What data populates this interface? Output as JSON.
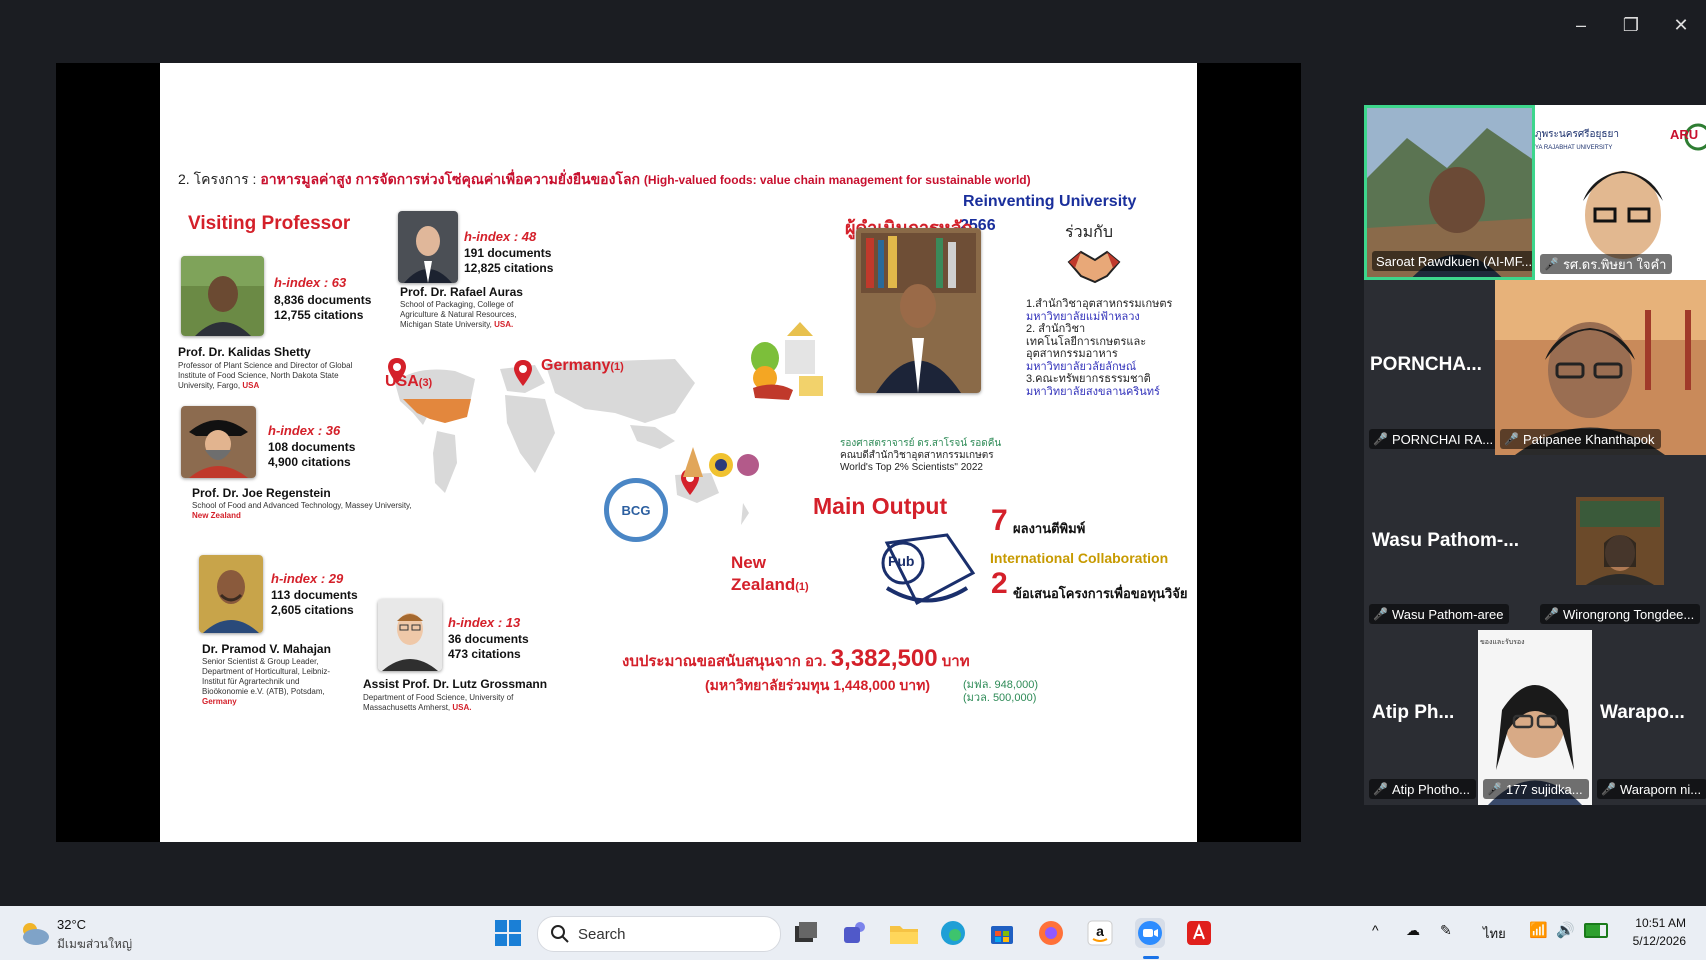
{
  "window": {
    "minimize_icon": "–",
    "restore_icon": "❐",
    "close_icon": "✕"
  },
  "slide": {
    "heading_prefix": "2. โครงการ : ",
    "heading_thai": "อาหารมูลค่าสูง การจัดการห่วงโซ่คุณค่าเพื่อความยั่งยืนของโลก",
    "heading_en": "(High-valued foods: value chain management for sustainable world)",
    "visiting_title": "Visiting Professor",
    "professors": [
      {
        "h": "h-index : 63",
        "docs": "8,836 documents",
        "cites": "12,755 citations",
        "name": "Prof. Dr. Kalidas Shetty",
        "aff": "Professor of Plant Science and Director of Global Institute of Food Science, North Dakota State University, Fargo,",
        "country": "USA"
      },
      {
        "h": "h-index : 48",
        "docs": "191 documents",
        "cites": "12,825 citations",
        "name": "Prof. Dr. Rafael Auras",
        "aff": "School of Packaging, College of Agriculture & Natural Resources, Michigan State University,",
        "country": "USA."
      },
      {
        "h": "h-index : 36",
        "docs": "108 documents",
        "cites": "4,900 citations",
        "name": "Prof. Dr. Joe Regenstein",
        "aff": "School of Food and Advanced Technology, Massey University,",
        "country": "New Zealand"
      },
      {
        "h": "h-index : 29",
        "docs": "113 documents",
        "cites": "2,605 citations",
        "name": "Dr. Pramod V. Mahajan",
        "aff": "Senior Scientist & Group Leader, Department of Horticultural, Leibniz-Institut für Agrartechnik und Bioökonomie e.V. (ATB), Potsdam,",
        "country": "Germany"
      },
      {
        "h": "h-index : 13",
        "docs": "36 documents",
        "cites": "473 citations",
        "name": "Assist Prof. Dr. Lutz Grossmann",
        "aff": "Department of Food Science, University of Massachusetts Amherst,",
        "country": "USA."
      }
    ],
    "countries": {
      "usa": "USA",
      "usa_count": "(3)",
      "germany": "Germany",
      "germany_count": "(1)",
      "nz1": "New",
      "nz2": "Zealand",
      "nz_count": "(1)"
    },
    "bcg_label": "BCG",
    "reinventing_line1": "Reinventing University",
    "reinventing_line2": "2566",
    "leader_title": "ผู้ดำเนินการหลัก",
    "with_label": "ร่วมกับ",
    "partners": [
      {
        "text": "1.สำนักวิชาอุตสาหกรรมเกษตร",
        "blue": false
      },
      {
        "text": "มหาวิทยาลัยแม่ฟ้าหลวง",
        "blue": true
      },
      {
        "text": "2. สำนักวิชา",
        "blue": false
      },
      {
        "text": "เทคโนโลยีการเกษตรและ",
        "blue": false
      },
      {
        "text": "อุตสาหกรรมอาหาร",
        "blue": false
      },
      {
        "text": "มหาวิทยาลัยวลัยลักษณ์",
        "blue": true
      },
      {
        "text": "3.คณะทรัพยากรธรรมชาติ",
        "blue": false
      },
      {
        "text": "มหาวิทยาลัยสงขลานครินทร์",
        "blue": true
      }
    ],
    "leader_caption1": "รองศาสตราจารย์ ดร.สาโรจน์ รอดคืน",
    "leader_caption2": "คณบดีสำนักวิชาอุตสาหกรรมเกษตร",
    "leader_caption3": "World's Top 2% Scientists\" 2022",
    "main_output": "Main Output",
    "output1_num": "7",
    "output1_label": "ผลงานตีพิมพ์",
    "international": "International Collaboration",
    "output2_num": "2",
    "output2_label": "ข้อเสนอโครงการเพื่อขอทุนวิจัย",
    "pub_label": "Pub",
    "budget_prefix": "งบประมาณขอสนับสนุนจาก อว.",
    "budget_amount": "3,382,500",
    "budget_unit": "บาท",
    "budget_joint": "(มหาวิทยาลัยร่วมทุน 1,448,000 บาท)",
    "budget_mfu": "(มฟล. 948,000)",
    "budget_mu": "(มวล. 500,000)"
  },
  "participants": [
    {
      "name": "Saroat Rawdkuen (AI-MF...",
      "muted": false,
      "active": true
    },
    {
      "name": "รศ.ดร.พิษยา ใจคำ",
      "muted": true,
      "logo_text": "ภูพระนครศรีอยุธยา",
      "logo_sub": "YA RAJABHAT UNIVERSITY",
      "logo_aru": "ARU"
    },
    {
      "big": "PORNCHA...",
      "name": "PORNCHAI RA...",
      "muted": true
    },
    {
      "name": "Patipanee Khanthapok",
      "muted": true
    },
    {
      "big": "Wasu  Pathom-...",
      "name": "Wasu Pathom-aree",
      "muted": true
    },
    {
      "name": "Wirongrong Tongdee...",
      "muted": true
    },
    {
      "big": "Atip  Ph...",
      "name": "Atip Photho...",
      "muted": true
    },
    {
      "name": "177 sujidka...",
      "muted": true,
      "top_text": "ของและรับรอง"
    },
    {
      "big": "Warapo...",
      "name": "Waraporn ni...",
      "muted": true
    }
  ],
  "taskbar": {
    "weather_temp": "32°C",
    "weather_desc": "มีเมฆส่วนใหญ่",
    "search_placeholder": "Search",
    "lang": "ไทย",
    "time": "10:51 AM",
    "date": "5/12/2026",
    "apps": [
      "windows-start",
      "task-view",
      "teams",
      "file-explorer",
      "edge",
      "microsoft-store",
      "firefox",
      "amazon",
      "zoom",
      "acrobat"
    ]
  }
}
